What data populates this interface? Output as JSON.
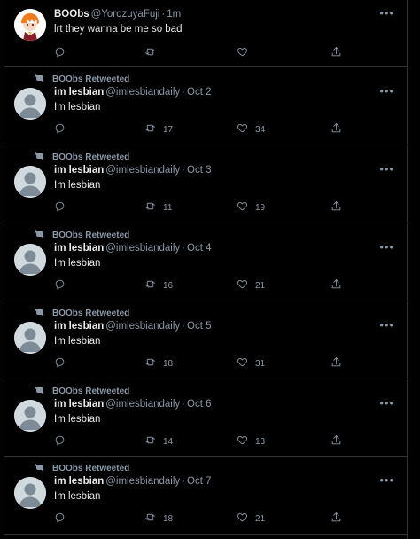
{
  "tweets": [
    {
      "retweeted_by": "",
      "name": "BOObs",
      "handle": "@YorozuyaFuji",
      "time": "1m",
      "text": "lrt they wanna be me so bad",
      "replies": "",
      "retweets": "",
      "likes": "",
      "avatar": "anime"
    },
    {
      "retweeted_by": "BOObs Retweeted",
      "name": "im lesbian",
      "handle": "@imlesbiandaily",
      "time": "Oct 2",
      "text": "Im lesbian",
      "replies": "",
      "retweets": "17",
      "likes": "34",
      "avatar": "default"
    },
    {
      "retweeted_by": "BOObs Retweeted",
      "name": "im lesbian",
      "handle": "@imlesbiandaily",
      "time": "Oct 3",
      "text": "Im lesbian",
      "replies": "",
      "retweets": "11",
      "likes": "19",
      "avatar": "default"
    },
    {
      "retweeted_by": "BOObs Retweeted",
      "name": "im lesbian",
      "handle": "@imlesbiandaily",
      "time": "Oct 4",
      "text": "Im lesbian",
      "replies": "",
      "retweets": "16",
      "likes": "21",
      "avatar": "default"
    },
    {
      "retweeted_by": "BOObs Retweeted",
      "name": "im lesbian",
      "handle": "@imlesbiandaily",
      "time": "Oct 5",
      "text": "Im lesbian",
      "replies": "",
      "retweets": "18",
      "likes": "31",
      "avatar": "default"
    },
    {
      "retweeted_by": "BOObs Retweeted",
      "name": "im lesbian",
      "handle": "@imlesbiandaily",
      "time": "Oct 6",
      "text": "Im lesbian",
      "replies": "",
      "retweets": "14",
      "likes": "13",
      "avatar": "default"
    },
    {
      "retweeted_by": "BOObs Retweeted",
      "name": "im lesbian",
      "handle": "@imlesbiandaily",
      "time": "Oct 7",
      "text": "Im lesbian",
      "replies": "",
      "retweets": "18",
      "likes": "21",
      "avatar": "default"
    }
  ],
  "icons": {
    "retweet": "retweet-icon",
    "reply": "reply-icon",
    "like": "heart-icon",
    "share": "share-icon",
    "more": "more-icon"
  },
  "colors": {
    "background": "#000000",
    "text": "#e7e9ea",
    "secondary": "#8b98a5",
    "border": "#2f3336"
  }
}
